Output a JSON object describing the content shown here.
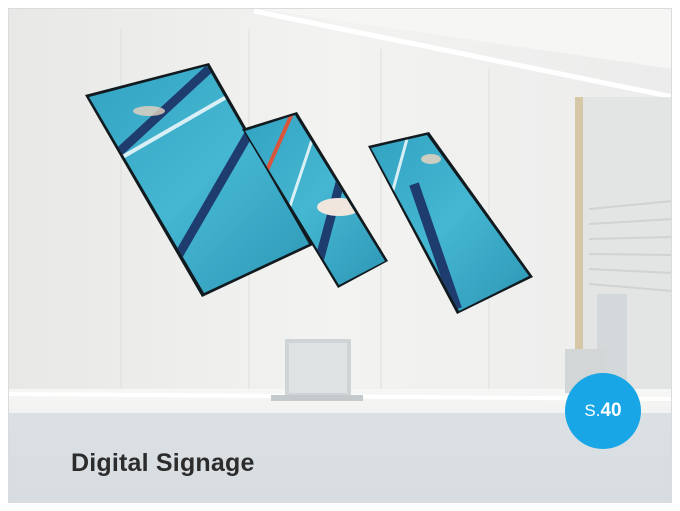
{
  "caption": {
    "title": "Digital Signage"
  },
  "badge": {
    "prefix": "S.",
    "page": "40"
  },
  "colors": {
    "badge": "#18a6e6",
    "pool_water": "#34a9c7",
    "caption_text": "#2c2c2c"
  },
  "photo": {
    "subject": "three tilted display panels showing swimmers in a pool, mounted on a lobby wall above a reception desk with a laptop"
  }
}
